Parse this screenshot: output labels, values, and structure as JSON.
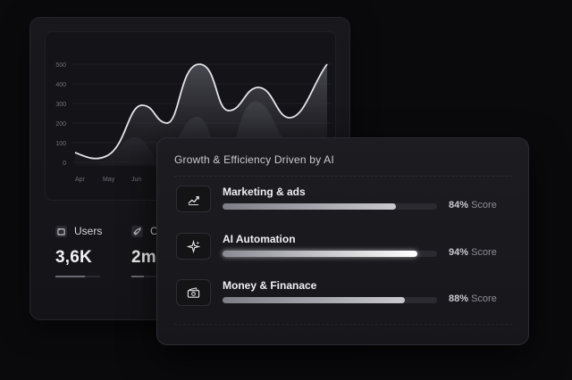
{
  "back_card": {
    "chart": {
      "y_ticks": [
        "500",
        "400",
        "300",
        "200",
        "100",
        "0"
      ],
      "x_labels": [
        "Apr",
        "May",
        "Jun"
      ]
    },
    "stats": [
      {
        "label": "Users",
        "value": "3,6K",
        "icon": "folder-icon",
        "progress": 0.65
      },
      {
        "label": "C",
        "value": "2m",
        "icon": "rocket-icon",
        "progress": 0.5
      }
    ]
  },
  "front_card": {
    "title": "Growth & Efficiency Driven by AI",
    "metrics": [
      {
        "name": "Marketing & ads",
        "percent": 84,
        "percent_label": "84%",
        "score_label": "Score",
        "icon": "trend-up-icon"
      },
      {
        "name": "AI Automation",
        "percent": 94,
        "percent_label": "94%",
        "score_label": "Score",
        "icon": "sparkles-icon"
      },
      {
        "name": "Money & Finanace",
        "percent": 88,
        "percent_label": "88%",
        "score_label": "Score",
        "icon": "banknote-icon"
      }
    ]
  },
  "colors": {
    "background": "#0a0a0d",
    "card": "#17171b",
    "accent": "#ffffff",
    "muted": "#8d8d95"
  }
}
